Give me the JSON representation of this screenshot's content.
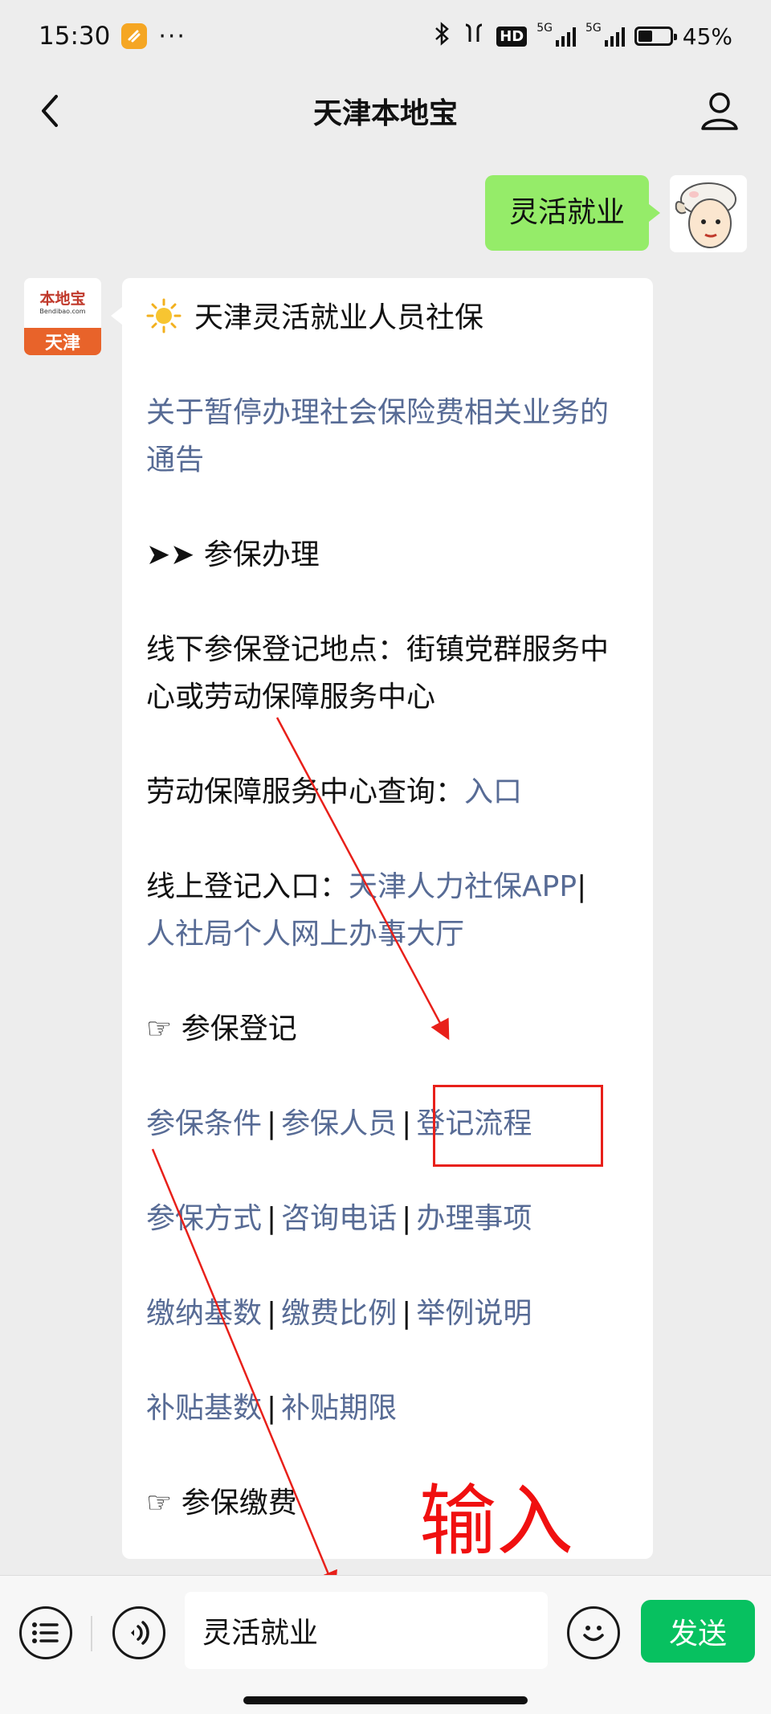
{
  "status_bar": {
    "time": "15:30",
    "more": "···",
    "network_hd": "HD",
    "network_5g_1": "5G",
    "network_5g_2": "5G",
    "battery_level": 0.45,
    "battery_pct": "45%"
  },
  "nav": {
    "title": "天津本地宝",
    "back_icon": "chevron-left-icon",
    "profile_icon": "user-icon"
  },
  "outgoing": {
    "text": "灵活就业"
  },
  "bot": {
    "logo_text": "本地宝",
    "logo_site": "Bendibao.com",
    "logo_city": "天津"
  },
  "reply": {
    "title": "天津灵活就业人员社保",
    "notice_link": "关于暂停办理社会保险费相关业务的通告",
    "section1_heading": "➤➤ 参保办理",
    "offline_text": "线下参保登记地点：街镇党群服务中心或劳动保障服务中心",
    "query_label": "劳动保障服务中心查询：",
    "query_link": "入口",
    "online_label": "线上登记入口：",
    "online_link1": "天津人力社保APP",
    "online_sep": "|",
    "online_link2": "人社局个人网上办事大厅",
    "section2_heading": "☞ 参保登记",
    "links_row1": [
      "参保条件",
      "参保人员",
      "登记流程"
    ],
    "links_row2": [
      "参保方式",
      "咨询电话",
      "办理事项"
    ],
    "links_row3": [
      "缴纳基数",
      "缴费比例",
      "举例说明"
    ],
    "links_row4": [
      "补贴基数",
      "补贴期限"
    ],
    "separator": "|",
    "section3_heading": "☞ 参保缴费"
  },
  "annotation": {
    "text": "输入",
    "color": "#f01010"
  },
  "input_bar": {
    "menu_icon": "menu-list-icon",
    "voice_icon": "voice-icon",
    "input_value": "灵活就业",
    "emoji_icon": "emoji-icon",
    "send_label": "发送"
  },
  "colors": {
    "link": "#576b95",
    "bubble_out": "#95ec69",
    "send_button": "#07c160",
    "background": "#ededed"
  }
}
